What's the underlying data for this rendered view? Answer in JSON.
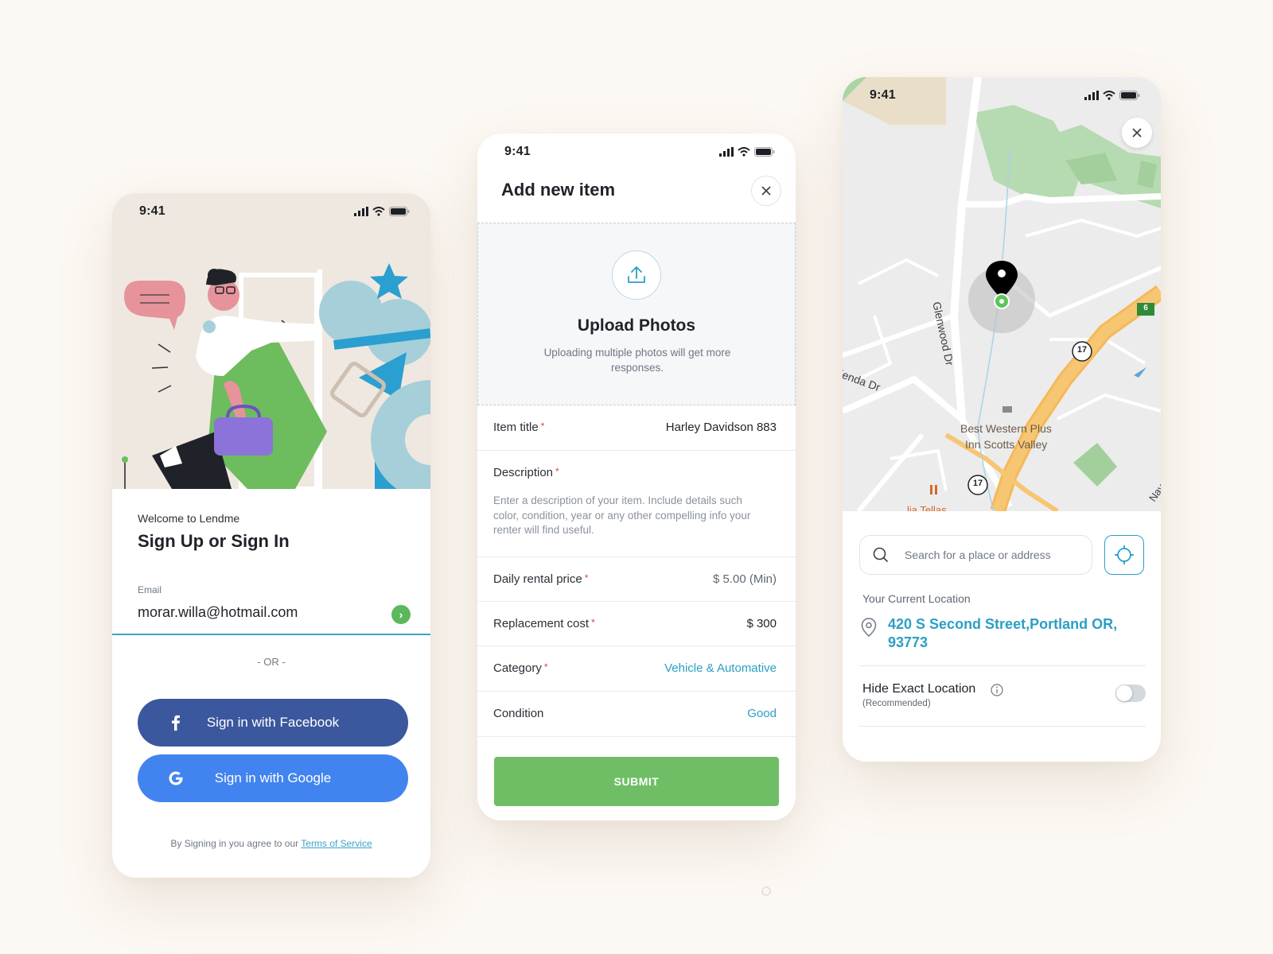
{
  "status": {
    "time": "9:41"
  },
  "signin": {
    "welcome": "Welcome to Lendme",
    "title": "Sign Up or Sign In",
    "email_label": "Email",
    "email_value": "morar.willa@hotmail.com",
    "or": "- OR -",
    "facebook_label": "Sign in with Facebook",
    "google_label": "Sign in with Google",
    "terms_prefix": "By Signing in you agree to our ",
    "terms_link": "Terms of Service",
    "colors": {
      "facebook": "#3b579d",
      "google": "#4284ef",
      "accent": "#3aa3c9",
      "go": "#5cb85c"
    }
  },
  "add_item": {
    "title": "Add new item",
    "upload_title": "Upload Photos",
    "upload_sub": "Uploading multiple photos will get more responses.",
    "fields": {
      "item_title": {
        "label": "Item title",
        "required": "*",
        "value": "Harley Davidson 883"
      },
      "description": {
        "label": "Description",
        "required": "*",
        "placeholder": "Enter a description of your item. Include details such color, condition, year or any other compelling info your renter will find useful."
      },
      "daily_price": {
        "label": "Daily rental price",
        "required": "*",
        "value": "$ 5.00 (Min)"
      },
      "replacement": {
        "label": "Replacement cost",
        "required": "*",
        "value": "$ 300"
      },
      "category": {
        "label": "Category",
        "required": "*",
        "value": "Vehicle & Automative"
      },
      "condition": {
        "label": "Condition",
        "value": "Good"
      }
    },
    "submit": "SUBMIT",
    "colors": {
      "submit": "#6fbe66",
      "link": "#2b9fc6",
      "required": "#e0433f"
    }
  },
  "location": {
    "map": {
      "street_1": "Glenwood Dr",
      "street_2": "ienda Dr",
      "street_3": "Nava",
      "poi": "Best Western Plus Inn Scotts Valley",
      "poi_line1": "Best Western Plus",
      "poi_line2": "Inn Scotts Valley",
      "poi_2": "lia Tellas",
      "route_17": "17",
      "route_6": "6"
    },
    "search_placeholder": "Search for a place or address",
    "current_label": "Your Current Location",
    "address": "420 S Second Street,Portland OR, 93773",
    "hide_label": "Hide Exact Location",
    "hide_sub": "(Recommended)",
    "hide_enabled": false,
    "icons": [
      "close-icon",
      "search-icon",
      "crosshair-icon",
      "location-pin-icon",
      "info-icon",
      "map-marker-icon"
    ]
  }
}
